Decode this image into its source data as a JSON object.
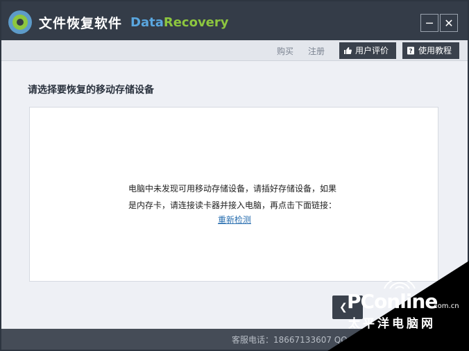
{
  "app": {
    "title": "文件恢复软件",
    "brand_part1": "Data",
    "brand_part2": "Recovery",
    "minimize_glyph": "─",
    "close_glyph": "✕"
  },
  "menu": {
    "buy": "购买",
    "register": "注册",
    "review": "用户评价",
    "tutorial": "使用教程"
  },
  "main": {
    "heading": "请选择要恢复的移动存储设备",
    "message_line1": "电脑中未发现可用移动存储设备，请插好存储设备，如果",
    "message_line2": "是内存卡，请连接读卡器并接入电脑，再点击下面链接：",
    "redetect_link": "重新检测",
    "back_glyph": "❮"
  },
  "status": {
    "text": "客服电话：18667133607 QQ：4"
  },
  "watermark": {
    "brand": "PConline",
    "domain": ".com.cn",
    "sub": "太平洋电脑网"
  },
  "colors": {
    "titlebar": "#343c48",
    "brand_blue": "#5aa7e0",
    "brand_green": "#8dc63f",
    "link": "#2a6fb0"
  }
}
